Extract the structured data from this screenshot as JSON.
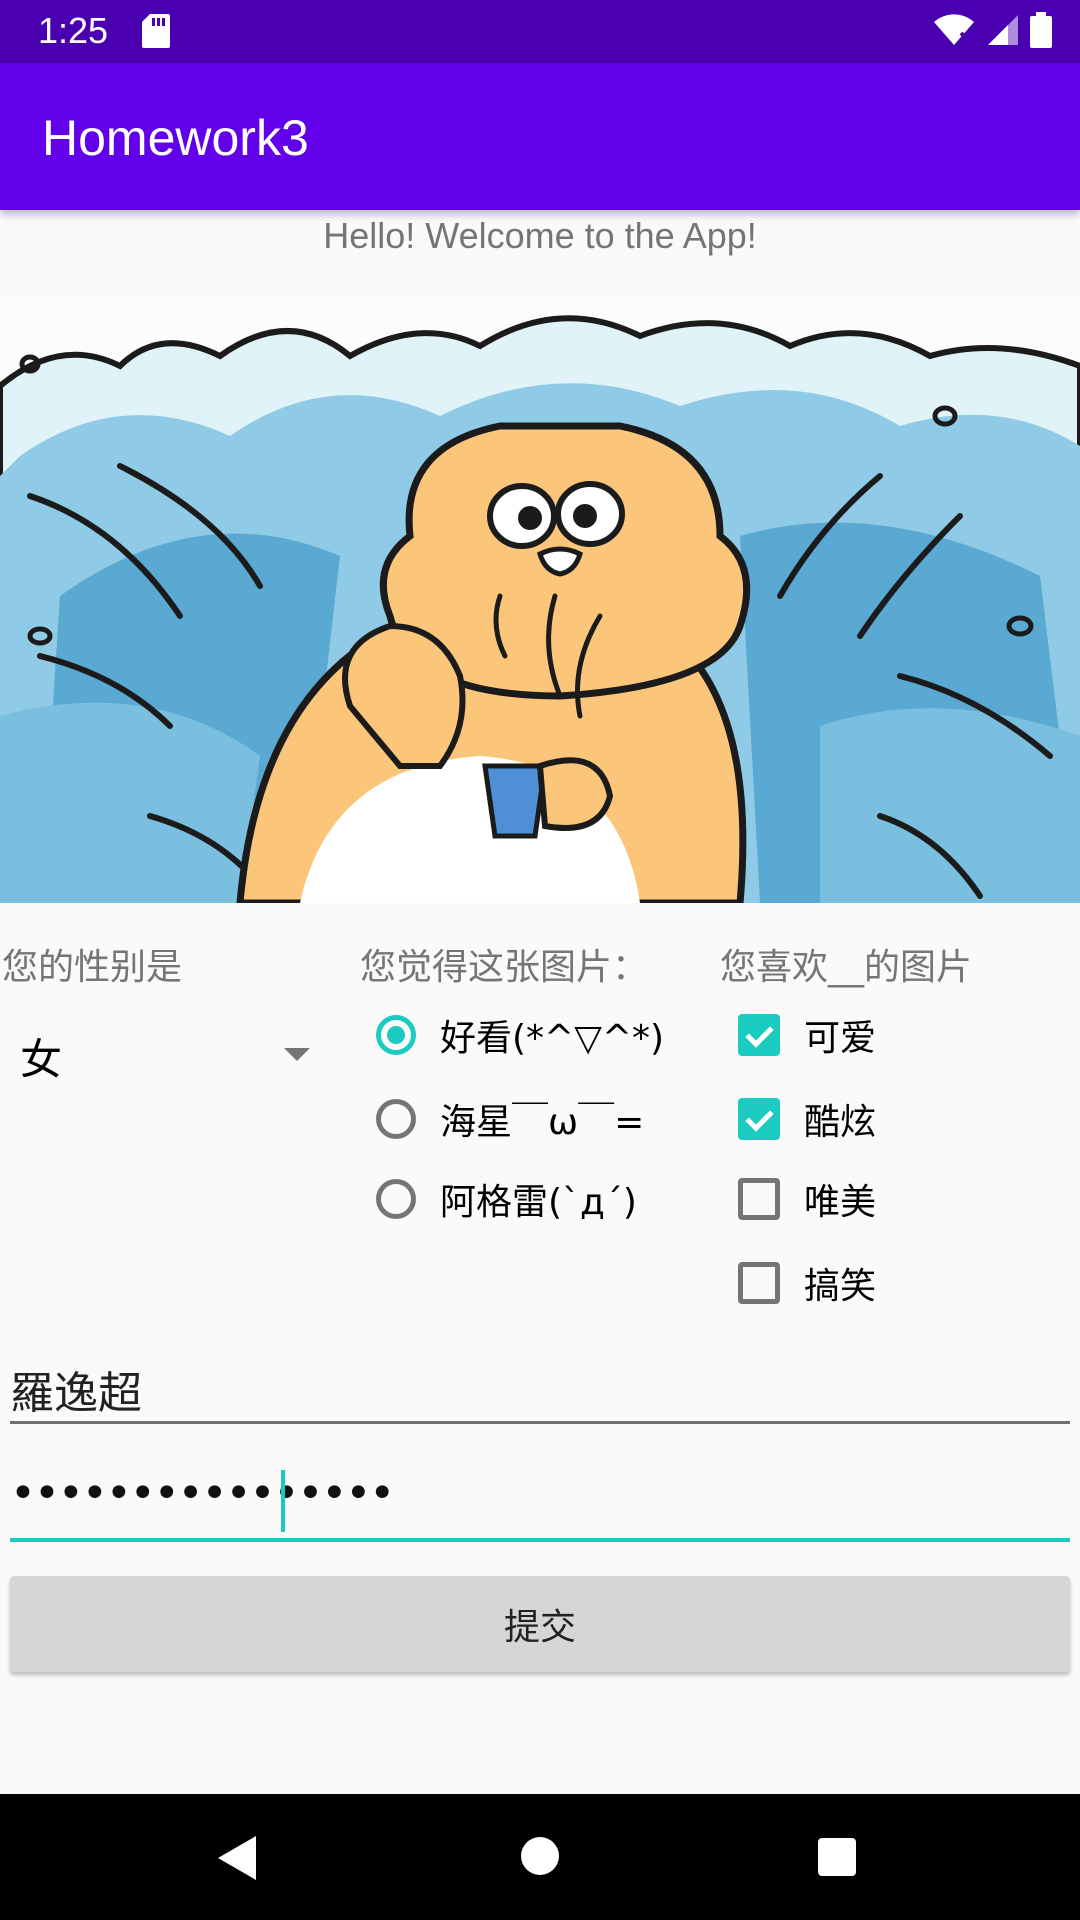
{
  "status_bar": {
    "time": "1:25",
    "icons": [
      "sd-card-icon",
      "wifi-icon",
      "signal-icon",
      "battery-icon"
    ]
  },
  "app_bar": {
    "title": "Homework3",
    "color": "#6200ea"
  },
  "welcome_text": "Hello! Welcome to the App!",
  "image": {
    "description_icon": "cartoon-hamster-illustration"
  },
  "gender": {
    "label": "您的性别是",
    "selected": "女"
  },
  "rating": {
    "label": "您觉得这张图片：",
    "options": [
      {
        "label": "好看(*^▽^*)",
        "selected": true
      },
      {
        "label": "海星￣ω￣=",
        "selected": false
      },
      {
        "label": "阿格雷(ˋдˊ)",
        "selected": false
      }
    ]
  },
  "likes": {
    "label": "您喜欢__的图片",
    "options": [
      {
        "label": "可爱",
        "checked": true
      },
      {
        "label": "酷炫",
        "checked": true
      },
      {
        "label": "唯美",
        "checked": false
      },
      {
        "label": "搞笑",
        "checked": false
      }
    ]
  },
  "name_field": {
    "value": "羅逸超"
  },
  "password_field": {
    "value": "••••••••••••••••"
  },
  "submit_button": {
    "label": "提交"
  },
  "colors": {
    "accent": "#1ccbc0",
    "primary": "#6200ea",
    "status_bar": "#4a00b0"
  }
}
